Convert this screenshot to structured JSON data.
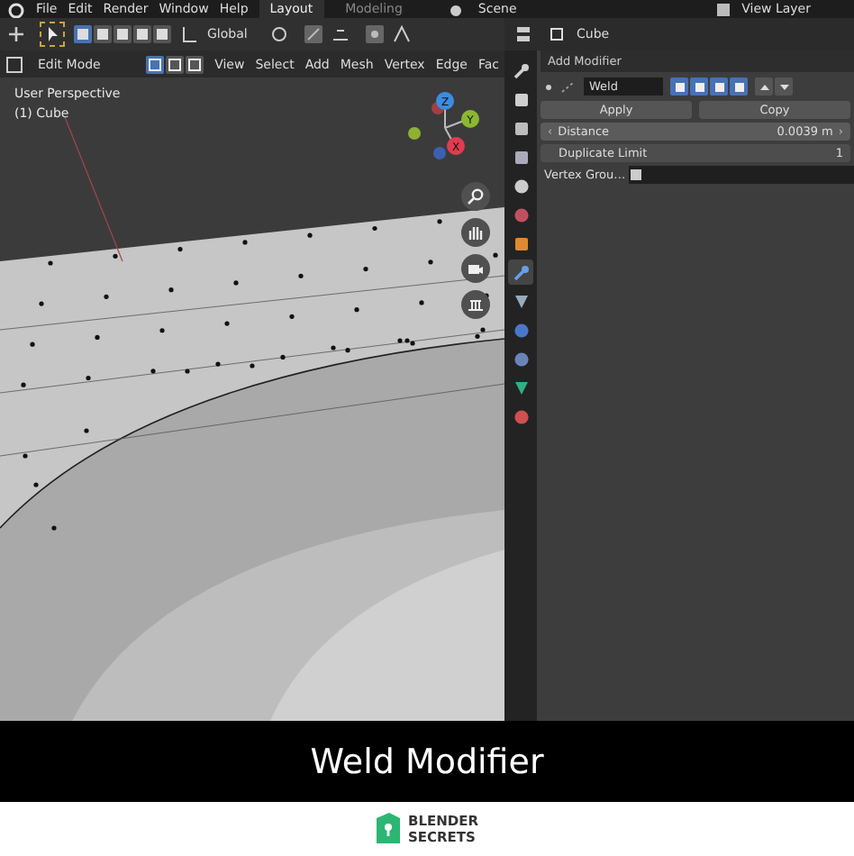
{
  "menu": [
    "File",
    "Edit",
    "Render",
    "Window",
    "Help"
  ],
  "workspaces": [
    {
      "label": "Layout",
      "selected": true
    },
    {
      "label": "Modeling",
      "selected": false
    }
  ],
  "scene": "Scene",
  "view_layer": "View Layer",
  "toolbar": {
    "orientation": "Global"
  },
  "mode": "Edit Mode",
  "select_modes": [
    {
      "selected": true
    },
    {
      "selected": false
    },
    {
      "selected": false
    }
  ],
  "viewport_menu": [
    "View",
    "Select",
    "Add",
    "Mesh",
    "Vertex",
    "Edge",
    "Fac"
  ],
  "viewport_info": [
    "User Perspective",
    "(1) Cube"
  ],
  "gizmo": {
    "z": "Z",
    "y": "Y",
    "x": "X"
  },
  "properties": {
    "object": "Cube",
    "add_modifier": "Add Modifier",
    "modifier": {
      "name": "Weld",
      "apply": "Apply",
      "copy": "Copy",
      "fields": [
        {
          "kind": "slider",
          "hovered": true,
          "left": "‹",
          "label": "Distance",
          "value": "0.0039 m",
          "right": "›"
        },
        {
          "kind": "number",
          "hovered": false,
          "label": "Duplicate Limit",
          "value": "1"
        },
        {
          "kind": "group",
          "label": "Vertex Grou…"
        }
      ]
    },
    "tabs": [
      {
        "kind": "tool",
        "selected": false
      },
      {
        "kind": "render",
        "selected": false
      },
      {
        "kind": "output",
        "selected": false
      },
      {
        "kind": "view",
        "selected": false
      },
      {
        "kind": "scene",
        "selected": false
      },
      {
        "kind": "world",
        "selected": false
      },
      {
        "kind": "object",
        "selected": false
      },
      {
        "kind": "modifier",
        "selected": true
      },
      {
        "kind": "particles",
        "selected": false
      },
      {
        "kind": "physics",
        "selected": false
      },
      {
        "kind": "constraints",
        "selected": false
      },
      {
        "kind": "data",
        "selected": false
      },
      {
        "kind": "material",
        "selected": false
      }
    ]
  },
  "caption": "Weld Modifier",
  "brand": [
    "BLENDER",
    "SECRETS"
  ]
}
